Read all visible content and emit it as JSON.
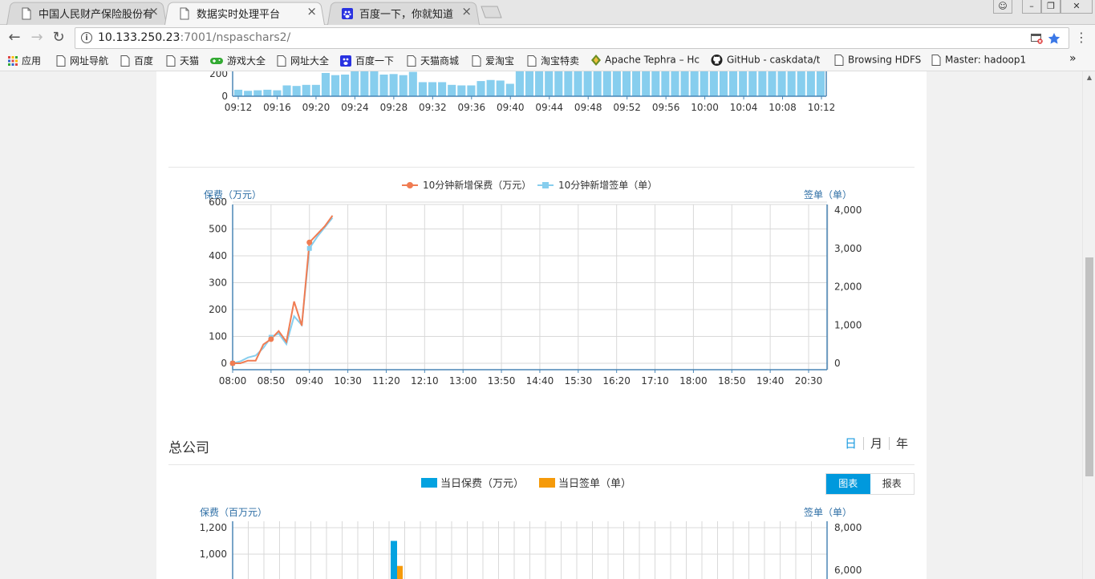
{
  "browser": {
    "tabs": [
      {
        "title": "中国人民财产保险股份有"
      },
      {
        "title": "数据实时处理平台"
      },
      {
        "title": "百度一下，你就知道"
      }
    ],
    "close_glyph": "×",
    "url_host": "10.133.250.23",
    "url_rest": ":7001/nspaschars2/",
    "bookmarks": [
      "应用",
      "网址导航",
      "百度",
      "天猫",
      "游戏大全",
      "网址大全",
      "百度一下",
      "天猫商城",
      "爱淘宝",
      "淘宝特卖",
      "Apache Tephra – Hc",
      "GitHub - caskdata/t",
      "Browsing HDFS",
      "Master: hadoop1"
    ],
    "more_glyph": "»"
  },
  "chart1": {
    "type": "bar",
    "yticks": [
      "0",
      "200"
    ],
    "xticks": [
      "09:12",
      "09:16",
      "09:20",
      "09:24",
      "09:28",
      "09:32",
      "09:36",
      "09:40",
      "09:44",
      "09:48",
      "09:52",
      "09:56",
      "10:00",
      "10:04",
      "10:08",
      "10:12"
    ],
    "values": [
      60,
      50,
      55,
      60,
      55,
      100,
      95,
      105,
      105,
      215,
      195,
      200,
      235,
      240,
      240,
      200,
      205,
      195,
      225,
      130,
      130,
      130,
      105,
      100,
      100,
      140,
      150,
      145,
      115,
      235,
      235,
      235,
      235,
      235,
      235,
      235,
      235,
      235,
      235,
      235,
      235,
      235,
      235,
      235,
      235,
      235,
      235,
      235,
      235,
      235,
      235,
      235,
      235,
      235,
      235,
      235,
      235,
      235,
      235,
      235,
      235
    ],
    "color": "#87ceee"
  },
  "chart2": {
    "type": "line",
    "legend": [
      "10分钟新增保费（万元）",
      "10分钟新增签单（单）"
    ],
    "ylabel_left": "保费（万元）",
    "ylabel_right": "签单（单）",
    "yticks_left": [
      "0",
      "100",
      "200",
      "300",
      "400",
      "500",
      "600"
    ],
    "yticks_right": [
      "0",
      "1,000",
      "2,000",
      "3,000",
      "4,000"
    ],
    "xticks": [
      "08:00",
      "08:50",
      "09:40",
      "10:30",
      "11:20",
      "12:10",
      "13:00",
      "13:50",
      "14:40",
      "15:30",
      "16:20",
      "17:10",
      "18:00",
      "18:50",
      "19:40",
      "20:30"
    ],
    "series": [
      {
        "name": "10分钟新增保费（万元）",
        "color": "#f07c52",
        "x": [
          0,
          10,
          20,
          30,
          40,
          50,
          60,
          70,
          80,
          90,
          100,
          110,
          120,
          130
        ],
        "values": [
          0,
          0,
          10,
          10,
          70,
          90,
          120,
          80,
          230,
          140,
          450,
          480,
          510,
          550
        ]
      },
      {
        "name": "10分钟新增签单（单）",
        "color": "#87ceee",
        "x": [
          0,
          10,
          20,
          30,
          40,
          50,
          60,
          70,
          80,
          90,
          100,
          110,
          120,
          130
        ],
        "values": [
          0,
          50,
          150,
          200,
          400,
          680,
          780,
          500,
          1230,
          1000,
          3000,
          3300,
          3550,
          3800
        ]
      }
    ]
  },
  "section": {
    "title": "总公司",
    "ranges": [
      "日",
      "月",
      "年"
    ],
    "toggle": [
      "图表",
      "报表"
    ]
  },
  "chart3": {
    "type": "bar",
    "legend": [
      "当日保费（万元）",
      "当日签单（单）"
    ],
    "ylabel_left": "保费（百万元）",
    "ylabel_right": "签单（单）",
    "yticks_left": [
      "1,000",
      "1,200"
    ],
    "yticks_right": [
      "6,000",
      "8,000"
    ],
    "series": [
      {
        "name": "当日保费（万元）",
        "color": "#03a2e0",
        "value": 1100
      },
      {
        "name": "当日签单（单）",
        "color": "#f59a0a",
        "value": 6200
      }
    ]
  }
}
